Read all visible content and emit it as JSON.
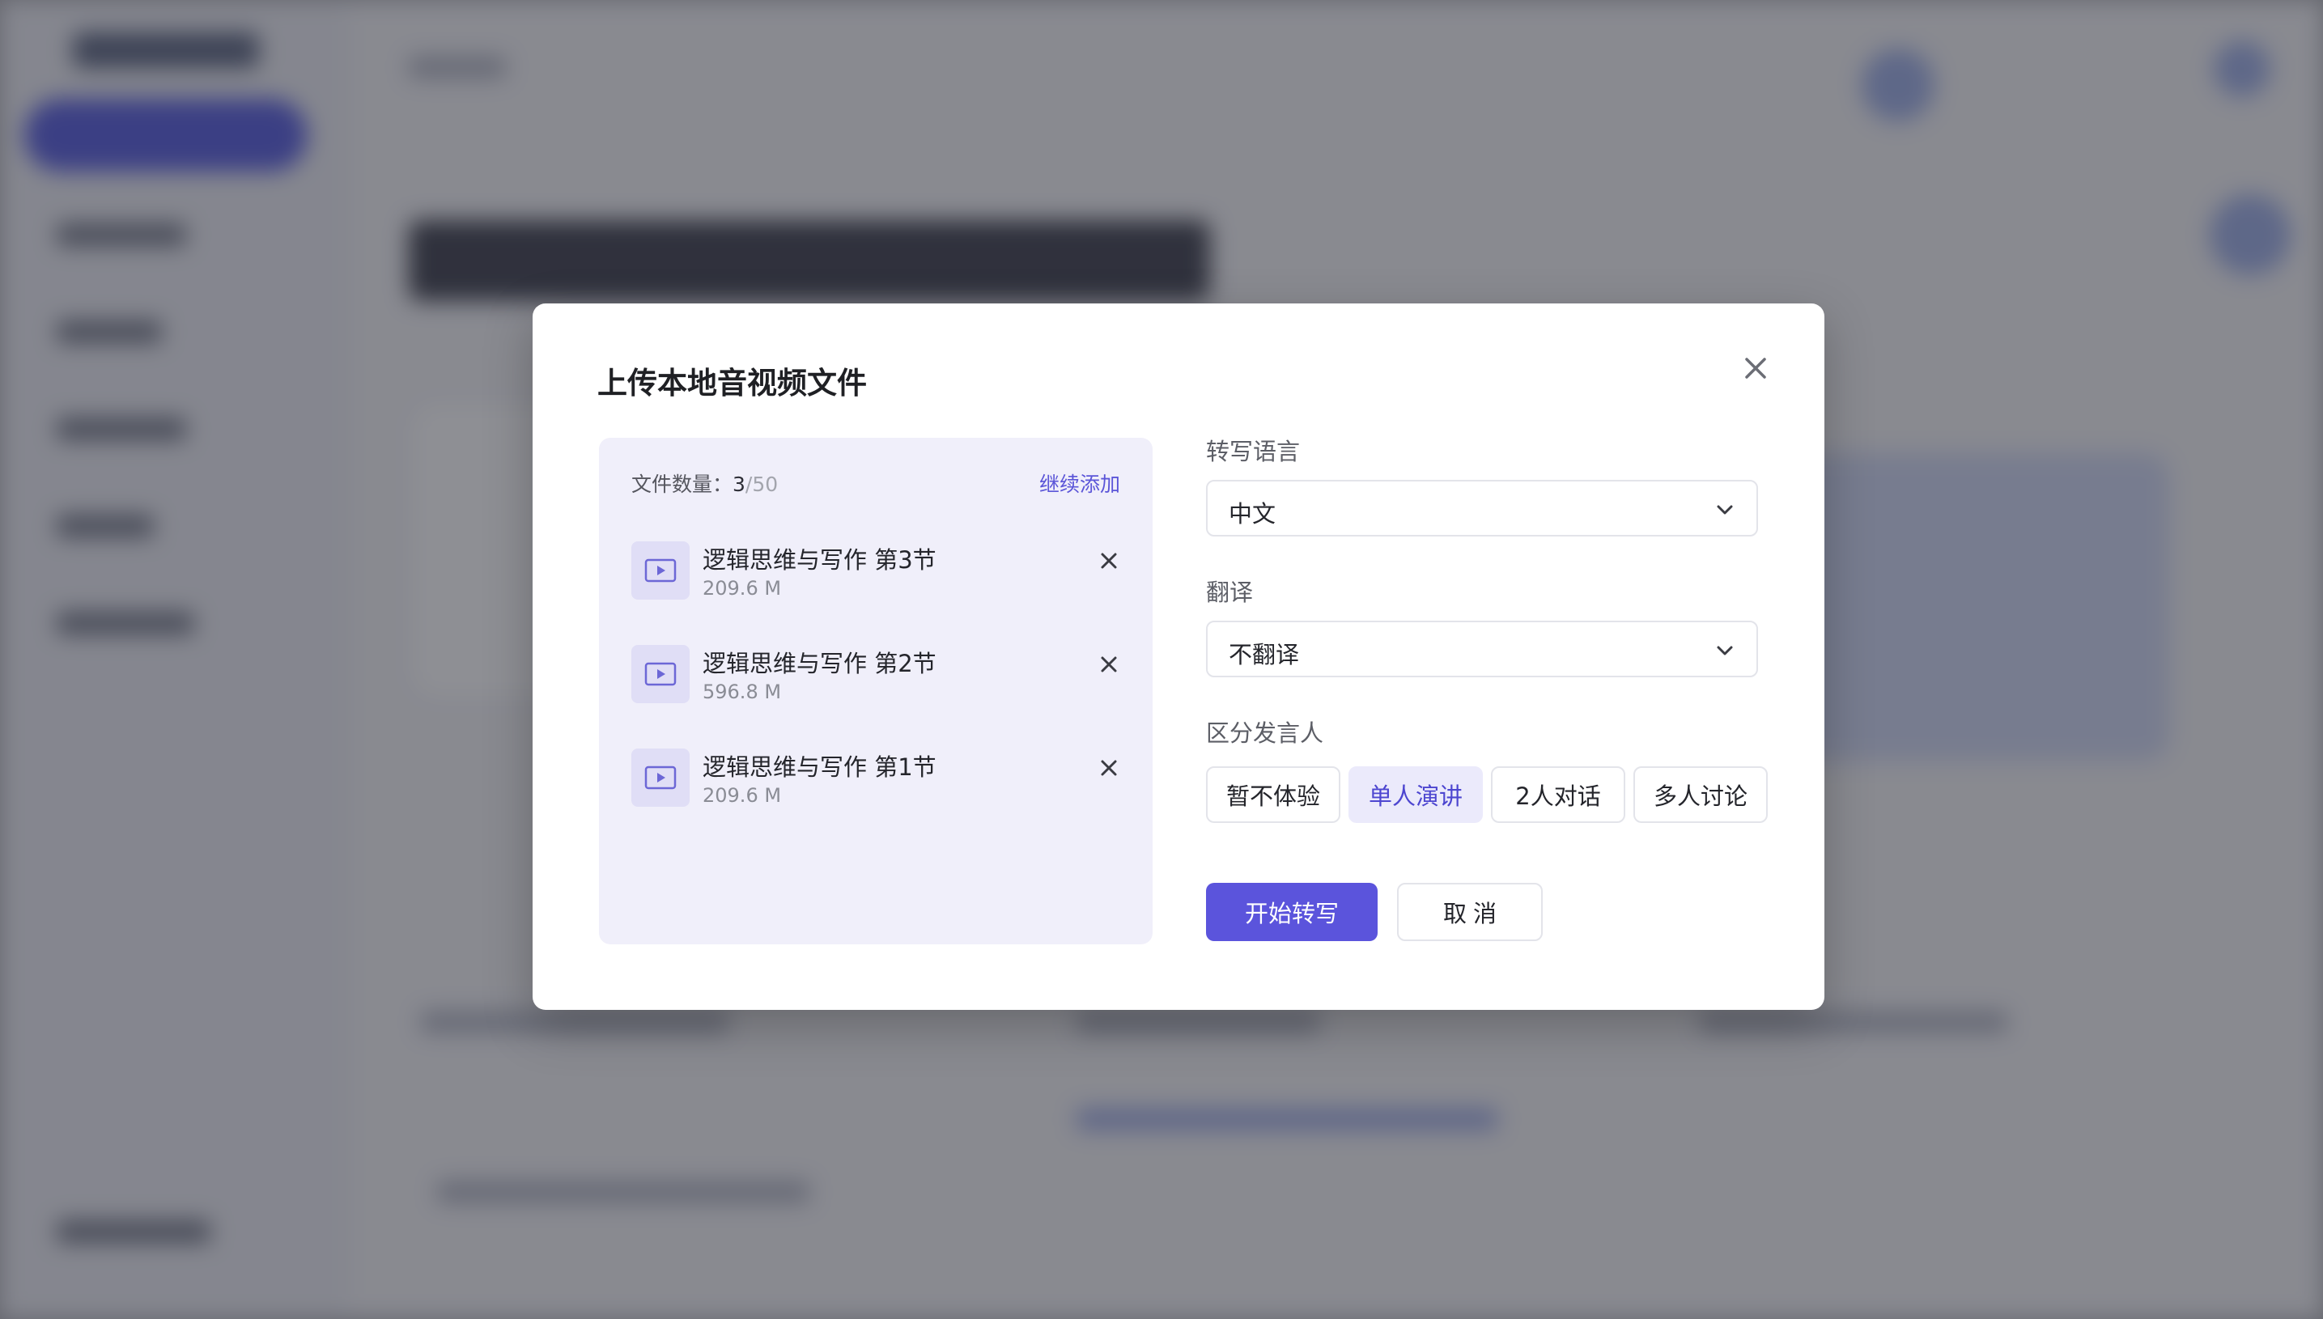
{
  "modal": {
    "title": "上传本地音视频文件",
    "close_icon": "close-icon"
  },
  "file_panel": {
    "count_label": "文件数量：",
    "count_current": "3",
    "count_max": "/50",
    "add_more_label": "继续添加",
    "files": [
      {
        "name": "逻辑思维与写作 第3节",
        "size": "209.6 M",
        "icon": "video-file-icon"
      },
      {
        "name": "逻辑思维与写作 第2节",
        "size": "596.8 M",
        "icon": "video-file-icon"
      },
      {
        "name": "逻辑思维与写作 第1节",
        "size": "209.6 M",
        "icon": "video-file-icon"
      }
    ]
  },
  "settings": {
    "transcribe_language": {
      "label": "转写语言",
      "value": "中文"
    },
    "translate": {
      "label": "翻译",
      "value": "不翻译"
    },
    "speaker": {
      "label": "区分发言人",
      "options": [
        "暂不体验",
        "单人演讲",
        "2人对话",
        "多人讨论"
      ],
      "selected": "单人演讲"
    }
  },
  "actions": {
    "start_label": "开始转写",
    "cancel_label": "取 消"
  },
  "colors": {
    "accent": "#5b54dc",
    "accent_light": "#ebeafb",
    "panel_bg": "#f0effa"
  }
}
